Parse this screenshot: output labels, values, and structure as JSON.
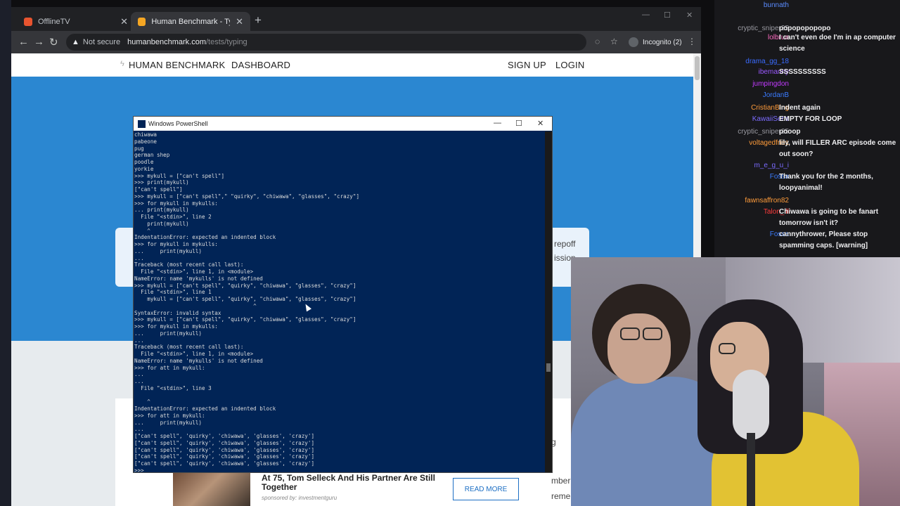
{
  "browser": {
    "tabs": [
      {
        "title": "OfflineTV",
        "favicon_color": "#e8542f"
      },
      {
        "title": "Human Benchmark - Typing Test",
        "favicon_color": "#f5a623"
      }
    ],
    "address": {
      "security": "Not secure",
      "host": "humanbenchmark.com",
      "path": "/tests/typing"
    },
    "incognito_label": "Incognito (2)"
  },
  "site": {
    "brand": "HUMAN BENCHMARK",
    "nav": {
      "dashboard": "DASHBOARD",
      "signup": "SIGN UP",
      "login": "LOGIN"
    },
    "card_right_line1": "repoff",
    "card_right_line2": "ission",
    "card2_right": "g",
    "card2_m1": "mber of",
    "card2_m2": "rement,",
    "card2_m3": "ling",
    "ad": {
      "headline": "At 75, Tom Selleck And His Partner Are Still Together",
      "sponsor": "sponsored by: investmentguru",
      "button": "READ MORE"
    }
  },
  "powershell": {
    "title": "Windows PowerShell",
    "lines": [
      "chiwawa",
      "pabeone",
      "pug",
      "german shep",
      "poodle",
      "yorkie",
      ">>> mykull = [\"can't spell\"]",
      ">>> print(mykull)",
      "[\"can't spell\"]",
      ">>> mykull = [\"can't spell\",\" \"quirky\", \"chiwawa\", \"glasses\", \"crazy\"]",
      ">>> for mykull in mykulls:",
      "... print(mykull)",
      "  File \"<stdin>\", line 2",
      "    print(mykull)",
      "    ^",
      "IndentationError: expected an indented block",
      ">>> for mykull in mykulls:",
      "...     print(mykull)",
      "...",
      "Traceback (most recent call last):",
      "  File \"<stdin>\", line 1, in <module>",
      "NameError: name 'mykulls' is not defined",
      ">>> mykull = [\"can't spell\", \"quirky\", \"chiwawa\", \"glasses\", \"crazy\"]",
      "  File \"<stdin>\", line 1",
      "    mykull = [\"can't spell\", \"quirky\", \"chiwawa\", \"glasses\", \"crazy\"]",
      "                                     ^",
      "SyntaxError: invalid syntax",
      ">>> mykull = [\"can't spell\", \"quirky\", \"chiwawa\", \"glasses\", \"crazy\"]",
      ">>> for mykull in mykulls:",
      "...     print(mykull)",
      "...",
      "Traceback (most recent call last):",
      "  File \"<stdin>\", line 1, in <module>",
      "NameError: name 'mykulls' is not defined",
      ">>> for att in mykull:",
      "...",
      "...",
      "  File \"<stdin>\", line 3",
      "",
      "    ^",
      "IndentationError: expected an indented block",
      ">>> for att in mykull:",
      "...     print(mykull)",
      "...",
      "[\"can't spell\", 'quirky', 'chiwawa', 'glasses', 'crazy']",
      "[\"can't spell\", 'quirky', 'chiwawa', 'glasses', 'crazy']",
      "[\"can't spell\", 'quirky', 'chiwawa', 'glasses', 'crazy']",
      "[\"can't spell\", 'quirky', 'chiwawa', 'glasses', 'crazy']",
      "[\"can't spell\", 'quirky', 'chiwawa', 'glasses', 'crazy']",
      ">>> _"
    ]
  },
  "chat": [
    {
      "name": "bunnath",
      "color": "#5b8cff",
      "text": ""
    },
    {
      "name": "cryptic_sniper35",
      "color": "#9a9aa2",
      "text": "popopopopopo"
    },
    {
      "name": "lolbrua",
      "color": "#ff6bc1",
      "text": "I can't even doe I'm in ap computer science"
    },
    {
      "name": "drama_gg_18",
      "color": "#3a6bff",
      "text": ""
    },
    {
      "name": "ibemanny",
      "color": "#9b59ff",
      "text": "SSSSSSSSSS"
    },
    {
      "name": "jumpingdon",
      "color": "#c23bff",
      "text": ""
    },
    {
      "name": "JordanB",
      "color": "#3a7bff",
      "text": ""
    },
    {
      "name": "CristianBing",
      "color": "#ff9c3b",
      "text": "Indent again"
    },
    {
      "name": "KawaiiSens",
      "color": "#7b6bff",
      "text": "EMPTY FOR LOOP"
    },
    {
      "name": "cryptic_sniper35",
      "color": "#9a9aa2",
      "text": "pooop"
    },
    {
      "name": "voltagedfriez",
      "color": "#ff9c3b",
      "text": "lily, will FILLER ARC episode come out soon?"
    },
    {
      "name": "m_e_g_u_i",
      "color": "#7b6bff",
      "text": ""
    },
    {
      "name": "Fossa",
      "color": "#3a7bff",
      "text": "Thank you for the 2 months, loopyanimal!"
    },
    {
      "name": "fawnsaffron82",
      "color": "#ff9c3b",
      "text": ""
    },
    {
      "name": "Talon_ill",
      "color": "#ff3b3b",
      "text": "Chiwawa is going to be fanart tomorrow isn't it?"
    },
    {
      "name": "Fossa",
      "color": "#3a7bff",
      "text": "cannythrower, Please stop spamming caps. [warning]"
    }
  ]
}
